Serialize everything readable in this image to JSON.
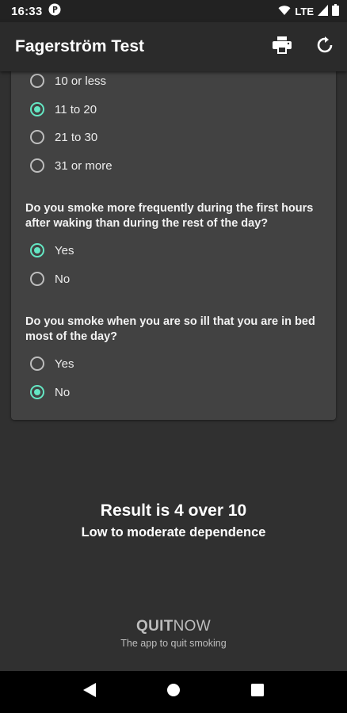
{
  "status_bar": {
    "time": "16:33",
    "network": "LTE",
    "icons": [
      "notification-icon",
      "wifi-icon",
      "signal-icon",
      "battery-icon"
    ]
  },
  "app_bar": {
    "title": "Fagerström Test",
    "actions": [
      "print-icon",
      "reset-icon"
    ]
  },
  "questions": [
    {
      "text": "",
      "options": [
        {
          "label": "10 or less",
          "checked": false
        },
        {
          "label": "11 to 20",
          "checked": true
        },
        {
          "label": "21 to 30",
          "checked": false
        },
        {
          "label": "31 or more",
          "checked": false
        }
      ]
    },
    {
      "text": "Do you smoke more frequently during the first hours after waking than during the rest of the day?",
      "options": [
        {
          "label": "Yes",
          "checked": true
        },
        {
          "label": "No",
          "checked": false
        }
      ]
    },
    {
      "text": "Do you smoke when you are so ill that you are in bed most of the day?",
      "options": [
        {
          "label": "Yes",
          "checked": false
        },
        {
          "label": "No",
          "checked": true
        }
      ]
    }
  ],
  "result": {
    "title": "Result is 4 over 10",
    "subtitle": "Low to moderate dependence"
  },
  "brand": {
    "quit": "QUIT",
    "now": "NOW",
    "tagline": "The app to quit smoking"
  },
  "accent_color": "#64e6c3",
  "nav_bar": [
    "back-icon",
    "home-icon",
    "recents-icon"
  ]
}
